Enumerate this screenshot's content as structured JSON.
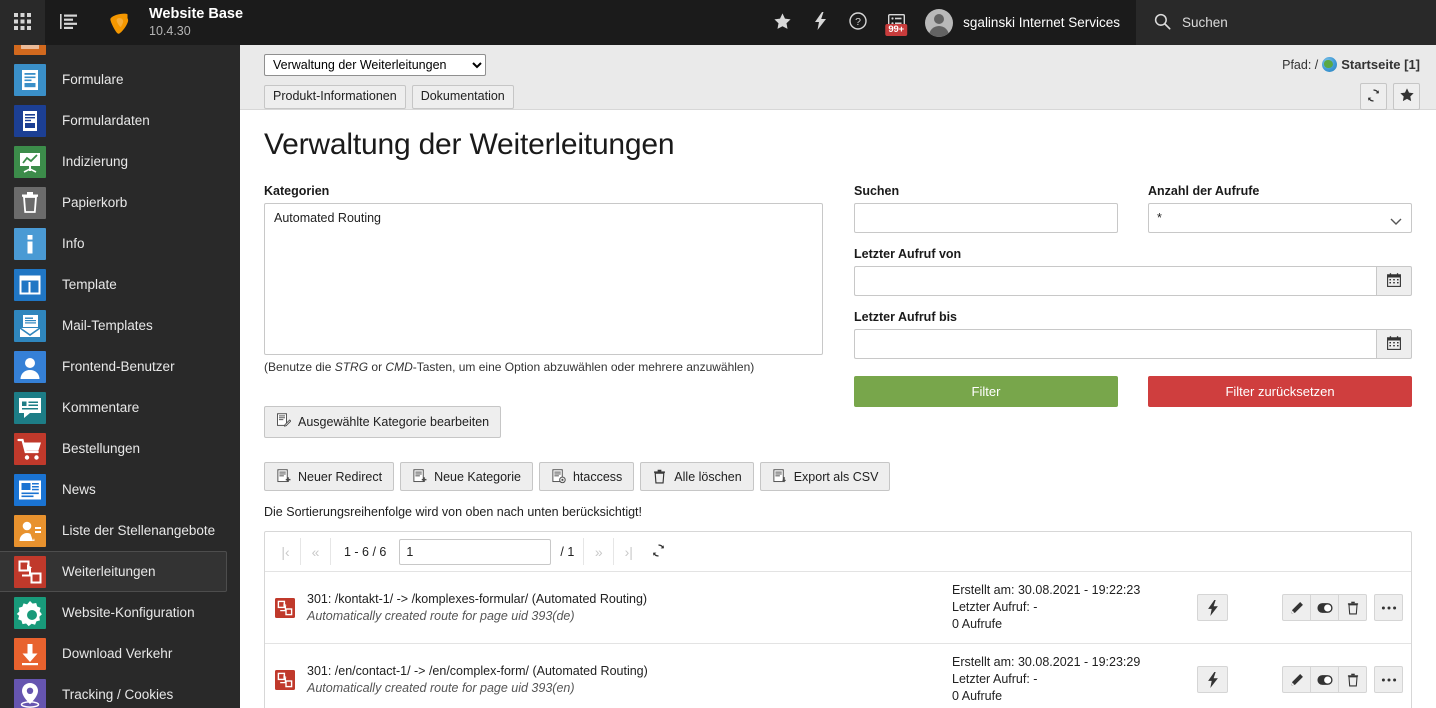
{
  "topbar": {
    "site_name": "Website Base",
    "version": "10.4.30",
    "bookmark_icon": "star-icon",
    "flash_icon": "lightning-bolt-icon",
    "help_icon": "question-mark-circle-icon",
    "systeminfo_icon": "system-information-icon",
    "notification_badge": "99+",
    "username": "sgalinski Internet Services",
    "search_label": "Suchen",
    "search_icon": "magnifier-icon",
    "module_menu_icon": "apps-grid-icon",
    "list_toggle_icon": "list-toggle-icon"
  },
  "sidebar": {
    "items": [
      {
        "label": "",
        "icon": "orange-module-icon",
        "color": "#d2691e",
        "active": false
      },
      {
        "label": "Formulare",
        "icon": "form-icon",
        "color": "#3a8fc8",
        "active": false
      },
      {
        "label": "Formulardaten",
        "icon": "form-data-icon",
        "color": "#1c3f94",
        "active": false
      },
      {
        "label": "Indizierung",
        "icon": "indexing-chart-icon",
        "color": "#3c8c4a",
        "active": false
      },
      {
        "label": "Papierkorb",
        "icon": "trash-icon",
        "color": "#6b6b6b",
        "active": false
      },
      {
        "label": "Info",
        "icon": "info-icon",
        "color": "#4a9ad4",
        "active": false
      },
      {
        "label": "Template",
        "icon": "template-layout-icon",
        "color": "#2076c4",
        "active": false
      },
      {
        "label": "Mail-Templates",
        "icon": "mail-template-icon",
        "color": "#2f86bd",
        "active": false
      },
      {
        "label": "Frontend-Benutzer",
        "icon": "frontend-user-icon",
        "color": "#3580d6",
        "active": false
      },
      {
        "label": "Kommentare",
        "icon": "comment-icon",
        "color": "#1d7d86",
        "active": false
      },
      {
        "label": "Bestellungen",
        "icon": "shopping-cart-icon",
        "color": "#c0392b",
        "active": false
      },
      {
        "label": "News",
        "icon": "news-icon",
        "color": "#1a73d2",
        "active": false
      },
      {
        "label": "Liste der Stellenangebote",
        "icon": "job-listing-icon",
        "color": "#e8922e",
        "active": false
      },
      {
        "label": "Weiterleitungen",
        "icon": "redirect-icon",
        "color": "#c0392b",
        "active": true
      },
      {
        "label": "Website-Konfiguration",
        "icon": "site-configuration-gear-icon",
        "color": "#189a7a",
        "active": false
      },
      {
        "label": "Download Verkehr",
        "icon": "download-traffic-icon",
        "color": "#e8622e",
        "active": false
      },
      {
        "label": "Tracking / Cookies",
        "icon": "tracking-pin-icon",
        "color": "#6655b0",
        "active": false
      }
    ]
  },
  "docheader": {
    "module_select_value": "Verwaltung der Weiterleitungen",
    "module_select_options": [
      "Verwaltung der Weiterleitungen"
    ],
    "buttons": [
      {
        "label": "Produkt-Informationen",
        "name": "product-information-button"
      },
      {
        "label": "Dokumentation",
        "name": "documentation-button"
      }
    ],
    "path_label": "Pfad: /",
    "path_page": "Startseite [1]",
    "reload_icon": "reload-icon",
    "bookmark_icon": "star-icon"
  },
  "main": {
    "title": "Verwaltung der Weiterleitungen",
    "categories": {
      "label": "Kategorien",
      "options": [
        "Automated Routing"
      ],
      "hint_prefix": "(Benutze die ",
      "hint_strg": "STRG",
      "hint_mid": " or ",
      "hint_cmd": "CMD",
      "hint_suffix": "-Tasten, um eine Option abzuwählen oder mehrere anzuwählen)"
    },
    "edit_category_button": {
      "label": "Ausgewählte Kategorie bearbeiten",
      "icon": "edit-record-icon"
    },
    "filters": {
      "search_label": "Suchen",
      "search_value": "",
      "hits_label": "Anzahl der Aufrufe",
      "hits_value": "*",
      "hits_options": [
        "*"
      ],
      "last_call_from_label": "Letzter Aufruf von",
      "last_call_from_value": "",
      "last_call_to_label": "Letzter Aufruf bis",
      "last_call_to_value": "",
      "calendar_icon": "calendar-icon",
      "filter_button": "Filter",
      "filter_button_color": "#78a64b",
      "reset_button": "Filter zurücksetzen",
      "reset_button_color": "#cf3e3e"
    },
    "toolbar": [
      {
        "label": "Neuer Redirect",
        "icon": "new-record-icon"
      },
      {
        "label": "Neue Kategorie",
        "icon": "new-category-icon"
      },
      {
        "label": "htaccess",
        "icon": "htaccess-icon"
      },
      {
        "label": "Alle löschen",
        "icon": "trash-icon"
      },
      {
        "label": "Export als CSV",
        "icon": "export-csv-icon"
      }
    ],
    "sort_note": "Die Sortierungsreihenfolge wird von oben nach unten berücksichtigt!",
    "pager": {
      "first_icon": "first-page-icon",
      "prev_icon": "previous-page-icon",
      "range": "1 - 6 / 6",
      "current_page": "1",
      "total_pages": "/ 1",
      "next_icon": "next-page-icon",
      "last_icon": "last-page-icon",
      "reload_icon": "reload-icon"
    },
    "records": [
      {
        "icon": "redirect-record-icon",
        "title": "301: /kontakt-1/ -> /komplexes-formular/ (Automated Routing)",
        "subtitle": "Automatically created route for page uid 393(de)",
        "created": "Erstellt am: 30.08.2021 - 19:22:23",
        "last_call": "Letzter Aufruf: -",
        "hits": "0 Aufrufe",
        "flash_icon": "lightning-bolt-icon",
        "actions": [
          "edit-icon",
          "toggle-hide-icon",
          "delete-icon",
          "more-options-icon"
        ]
      },
      {
        "icon": "redirect-record-icon",
        "title": "301: /en/contact-1/ -> /en/complex-form/ (Automated Routing)",
        "subtitle": "Automatically created route for page uid 393(en)",
        "created": "Erstellt am: 30.08.2021 - 19:23:29",
        "last_call": "Letzter Aufruf: -",
        "hits": "0 Aufrufe",
        "flash_icon": "lightning-bolt-icon",
        "actions": [
          "edit-icon",
          "toggle-hide-icon",
          "delete-icon",
          "more-options-icon"
        ]
      }
    ]
  }
}
